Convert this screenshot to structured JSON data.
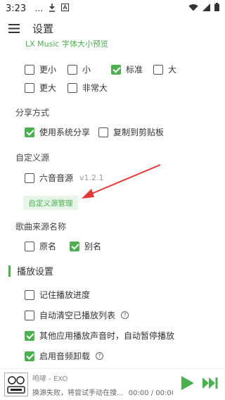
{
  "status_bar": {
    "time": "3:23",
    "icons": [
      "notification-more-icon",
      "download-icon",
      "a-icon",
      "wifi-icon",
      "signal-icon",
      "battery-icon"
    ]
  },
  "app_bar": {
    "menu_icon": "menu-icon",
    "title": "设置"
  },
  "font_size_preview": "LX Music 字体大小预览",
  "font_size_options": [
    {
      "label": "更小",
      "checked": false
    },
    {
      "label": "小",
      "checked": false
    },
    {
      "label": "标准",
      "checked": true
    },
    {
      "label": "大",
      "checked": false
    },
    {
      "label": "更大",
      "checked": false
    },
    {
      "label": "非常大",
      "checked": false
    }
  ],
  "share": {
    "title": "分享方式",
    "options": [
      {
        "label": "使用系统分享",
        "checked": true
      },
      {
        "label": "复制到剪贴板",
        "checked": false
      }
    ]
  },
  "custom_source": {
    "title": "自定义源",
    "option": {
      "label": "六音音源",
      "version": "v1.2.1",
      "checked": false
    },
    "manage_button": "自定义源管理"
  },
  "source_name": {
    "title": "歌曲来源名称",
    "options": [
      {
        "label": "原名",
        "checked": false
      },
      {
        "label": "别名",
        "checked": true
      }
    ]
  },
  "playback": {
    "title": "播放设置",
    "options": [
      {
        "label": "记住播放进度",
        "checked": false,
        "help": false
      },
      {
        "label": "自动清空已播放列表",
        "checked": false,
        "help": true
      },
      {
        "label": "其他应用播放声音时，自动暂停播放",
        "checked": true,
        "help": false
      },
      {
        "label": "启用音频卸载",
        "checked": true,
        "help": true
      }
    ]
  },
  "player": {
    "song": "咆哮 - EXO",
    "status": "换源失败，将尝试手动在搜...",
    "time": "00:00 / 00:00",
    "play_icon": "play-icon",
    "next_icon": "next-icon"
  },
  "colors": {
    "accent": "#4caf50",
    "arrow": "#e53935"
  }
}
